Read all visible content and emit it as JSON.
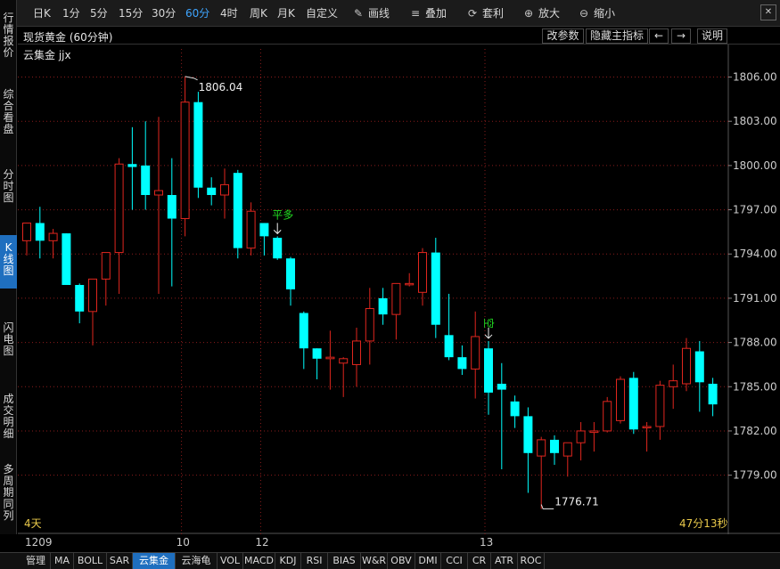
{
  "toolbar": {
    "periods": [
      "日K",
      "1分",
      "5分",
      "15分",
      "30分",
      "60分",
      "4时",
      "周K",
      "月K",
      "自定义"
    ],
    "active_period": "60分",
    "tools": [
      {
        "label": "画线",
        "icon": "pencil-icon"
      },
      {
        "label": "叠加",
        "icon": "layers-icon"
      },
      {
        "label": "套利",
        "icon": "refresh-icon"
      },
      {
        "label": "放大",
        "icon": "zoom-in-icon"
      },
      {
        "label": "缩小",
        "icon": "zoom-out-icon"
      }
    ],
    "close_icon": "close-icon"
  },
  "sidebar": {
    "items": [
      "行情报价",
      "综合看盘",
      "分时图",
      "K线图",
      "闪电图",
      "成交明细",
      "多周期同列"
    ],
    "active": "K线图"
  },
  "title_bar": {
    "title": "现货黄金 (60分钟)",
    "buttons": [
      "改参数",
      "隐藏主指标",
      "←",
      "→",
      "说明"
    ]
  },
  "indicator_label": "云集金 jjx",
  "range_left": "4天",
  "range_right": "47分13秒",
  "colors": {
    "up": "#e0261e",
    "down": "#00ffff",
    "grid": "#8a1c1c",
    "signal": "#22dd22",
    "axis_text": "#cccccc"
  },
  "chart_data": {
    "type": "candlestick",
    "title": "现货黄金 (60分钟)",
    "y_ticks": [
      "1806.00",
      "1803.00",
      "1800.00",
      "1797.00",
      "1794.00",
      "1791.00",
      "1788.00",
      "1785.00",
      "1782.00",
      "1779.00"
    ],
    "ylim": [
      1776.2,
      1807.3
    ],
    "x_labels": [
      {
        "index": 0,
        "label": "1209"
      },
      {
        "index": 12,
        "label": "10"
      },
      {
        "index": 18,
        "label": "12"
      },
      {
        "index": 35,
        "label": "13"
      }
    ],
    "candles": [
      {
        "o": 1794.9,
        "h": 1796.0,
        "l": 1793.9,
        "c": 1796.1
      },
      {
        "o": 1796.1,
        "h": 1797.2,
        "l": 1793.7,
        "c": 1794.9
      },
      {
        "o": 1794.9,
        "h": 1795.7,
        "l": 1793.7,
        "c": 1795.4
      },
      {
        "o": 1795.4,
        "h": 1795.4,
        "l": 1792.3,
        "c": 1791.9
      },
      {
        "o": 1791.9,
        "h": 1792.0,
        "l": 1789.3,
        "c": 1790.1
      },
      {
        "o": 1790.1,
        "h": 1792.0,
        "l": 1787.8,
        "c": 1792.3
      },
      {
        "o": 1792.3,
        "h": 1793.5,
        "l": 1790.5,
        "c": 1794.1
      },
      {
        "o": 1794.1,
        "h": 1800.5,
        "l": 1791.3,
        "c": 1800.1
      },
      {
        "o": 1800.1,
        "h": 1802.6,
        "l": 1797.0,
        "c": 1799.9
      },
      {
        "o": 1800.0,
        "h": 1803.0,
        "l": 1797.0,
        "c": 1798.0
      },
      {
        "o": 1798.0,
        "h": 1803.3,
        "l": 1791.3,
        "c": 1798.3
      },
      {
        "o": 1798.0,
        "h": 1800.5,
        "l": 1791.8,
        "c": 1796.4
      },
      {
        "o": 1796.4,
        "h": 1806.04,
        "l": 1795.2,
        "c": 1804.3
      },
      {
        "o": 1804.3,
        "h": 1805.0,
        "l": 1797.8,
        "c": 1798.5
      },
      {
        "o": 1798.5,
        "h": 1799.2,
        "l": 1797.3,
        "c": 1798.0
      },
      {
        "o": 1798.0,
        "h": 1799.8,
        "l": 1796.4,
        "c": 1798.7
      },
      {
        "o": 1799.5,
        "h": 1799.7,
        "l": 1793.7,
        "c": 1794.4
      },
      {
        "o": 1794.4,
        "h": 1797.5,
        "l": 1793.9,
        "c": 1796.9
      },
      {
        "o": 1796.1,
        "h": 1796.1,
        "l": 1793.9,
        "c": 1795.2
      },
      {
        "o": 1795.1,
        "h": 1795.2,
        "l": 1793.6,
        "c": 1793.7
      },
      {
        "o": 1793.7,
        "h": 1793.8,
        "l": 1790.5,
        "c": 1791.6
      },
      {
        "o": 1790.0,
        "h": 1790.1,
        "l": 1786.2,
        "c": 1787.6
      },
      {
        "o": 1787.6,
        "h": 1787.6,
        "l": 1785.5,
        "c": 1786.9
      },
      {
        "o": 1786.9,
        "h": 1788.8,
        "l": 1784.8,
        "c": 1787.0
      },
      {
        "o": 1786.6,
        "h": 1787.0,
        "l": 1784.3,
        "c": 1786.9
      },
      {
        "o": 1786.5,
        "h": 1789.0,
        "l": 1785.0,
        "c": 1788.1
      },
      {
        "o": 1788.1,
        "h": 1791.7,
        "l": 1786.5,
        "c": 1790.3
      },
      {
        "o": 1791.0,
        "h": 1791.7,
        "l": 1789.2,
        "c": 1789.9
      },
      {
        "o": 1789.9,
        "h": 1792.0,
        "l": 1788.2,
        "c": 1792.0
      },
      {
        "o": 1792.0,
        "h": 1792.7,
        "l": 1791.8,
        "c": 1792.0
      },
      {
        "o": 1791.4,
        "h": 1794.4,
        "l": 1790.5,
        "c": 1794.1
      },
      {
        "o": 1794.1,
        "h": 1795.1,
        "l": 1788.3,
        "c": 1789.2
      },
      {
        "o": 1788.5,
        "h": 1791.3,
        "l": 1786.8,
        "c": 1787.0
      },
      {
        "o": 1787.0,
        "h": 1787.8,
        "l": 1785.8,
        "c": 1786.2
      },
      {
        "o": 1786.2,
        "h": 1790.1,
        "l": 1784.2,
        "c": 1788.4
      },
      {
        "o": 1787.6,
        "h": 1788.1,
        "l": 1783.1,
        "c": 1784.6
      },
      {
        "o": 1785.2,
        "h": 1786.6,
        "l": 1779.4,
        "c": 1784.8
      },
      {
        "o": 1784.0,
        "h": 1784.4,
        "l": 1782.2,
        "c": 1783.0
      },
      {
        "o": 1783.0,
        "h": 1783.6,
        "l": 1777.8,
        "c": 1780.5
      },
      {
        "o": 1780.3,
        "h": 1781.6,
        "l": 1776.71,
        "c": 1781.4
      },
      {
        "o": 1781.4,
        "h": 1781.7,
        "l": 1779.7,
        "c": 1780.5
      },
      {
        "o": 1780.3,
        "h": 1781.2,
        "l": 1778.9,
        "c": 1781.2
      },
      {
        "o": 1781.2,
        "h": 1782.6,
        "l": 1780.0,
        "c": 1782.0
      },
      {
        "o": 1781.9,
        "h": 1782.6,
        "l": 1780.6,
        "c": 1782.0
      },
      {
        "o": 1782.0,
        "h": 1784.3,
        "l": 1781.9,
        "c": 1784.0
      },
      {
        "o": 1782.7,
        "h": 1785.7,
        "l": 1782.5,
        "c": 1785.5
      },
      {
        "o": 1785.6,
        "h": 1786.0,
        "l": 1781.8,
        "c": 1782.1
      },
      {
        "o": 1782.3,
        "h": 1782.6,
        "l": 1780.6,
        "c": 1782.3
      },
      {
        "o": 1782.3,
        "h": 1785.4,
        "l": 1781.4,
        "c": 1785.1
      },
      {
        "o": 1785.0,
        "h": 1786.5,
        "l": 1783.5,
        "c": 1785.4
      },
      {
        "o": 1785.2,
        "h": 1788.3,
        "l": 1784.7,
        "c": 1787.6
      },
      {
        "o": 1787.4,
        "h": 1788.1,
        "l": 1783.3,
        "c": 1785.3
      },
      {
        "o": 1785.2,
        "h": 1785.6,
        "l": 1783.0,
        "c": 1783.8
      }
    ],
    "high_label": "1806.04",
    "low_label": "1776.71",
    "signals": [
      {
        "index": 19,
        "label": "平多",
        "direction": "down"
      },
      {
        "index": 35,
        "label": "空",
        "direction": "down"
      }
    ]
  },
  "bottom_tabs": [
    "管理",
    "MA",
    "BOLL",
    "SAR",
    "云集金",
    "云海龟",
    "VOL",
    "MACD",
    "KDJ",
    "RSI",
    "BIAS",
    "W&R",
    "OBV",
    "DMI",
    "CCI",
    "CR",
    "ATR",
    "ROC"
  ],
  "active_tab": "云集金"
}
